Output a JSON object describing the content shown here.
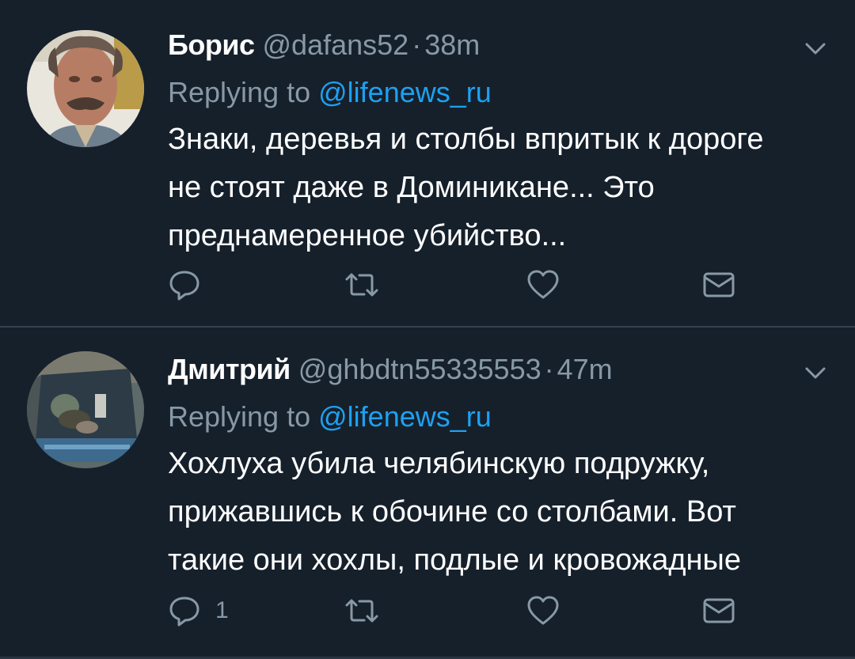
{
  "tweets": [
    {
      "author_name": "Борис",
      "author_handle": "@dafans52",
      "separator": "·",
      "time": "38m",
      "replying_prefix": "Replying to",
      "replying_to": "@lifenews_ru",
      "text_lines": [
        "Знаки, деревья и столбы впритык к дороге",
        "не стоят даже в Доминикане... Это",
        "преднамеренное убийство..."
      ],
      "reply_count": "",
      "icons": [
        "reply-icon",
        "retweet-icon",
        "like-icon",
        "direct-message-icon"
      ]
    },
    {
      "author_name": "Дмитрий",
      "author_handle": "@ghbdtn55335553",
      "separator": "·",
      "time": "47m",
      "replying_prefix": "Replying to",
      "replying_to": "@lifenews_ru",
      "text_lines": [
        "Хохлуха убила челябинскую подружку,",
        "прижавшись к обочине со столбами. Вот",
        "такие они хохлы, подлые и кровожадные"
      ],
      "reply_count": "1",
      "icons": [
        "reply-icon",
        "retweet-icon",
        "like-icon",
        "direct-message-icon"
      ]
    }
  ],
  "colors": {
    "background": "#16202b",
    "divider": "#36414d",
    "secondary_text": "#8899a6",
    "link": "#1da1f2",
    "primary_text": "#ffffff"
  }
}
